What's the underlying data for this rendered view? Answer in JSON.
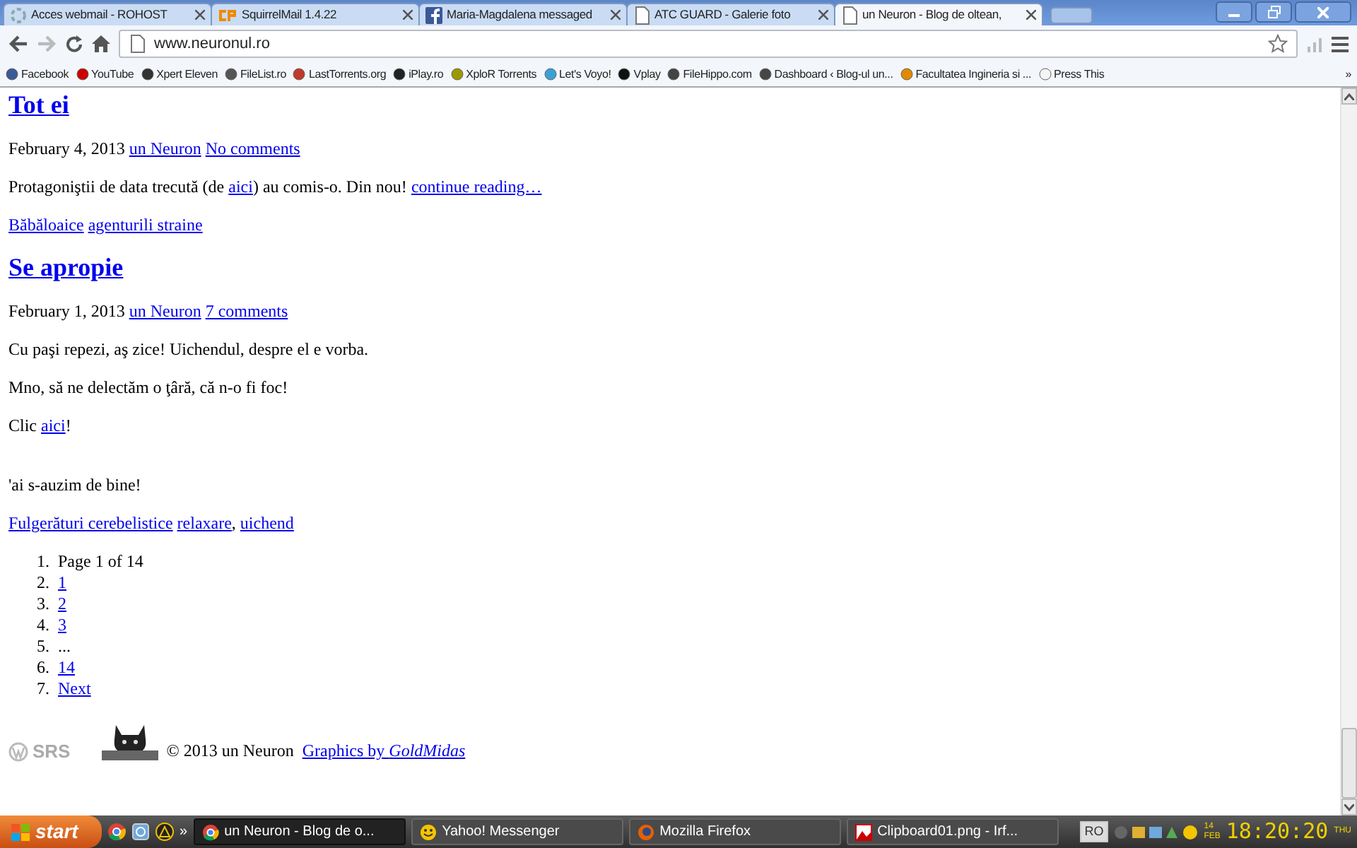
{
  "browser": {
    "tabs": [
      {
        "title": "Acces webmail - ROHOST",
        "kind": "spinner",
        "selected": false
      },
      {
        "title": "SquirrelMail 1.4.22",
        "kind": "cp",
        "selected": false
      },
      {
        "title": "Maria-Magdalena messaged",
        "kind": "facebook",
        "selected": false
      },
      {
        "title": "ATC GUARD - Galerie foto",
        "kind": "page",
        "selected": false
      },
      {
        "title": "un Neuron - Blog de oltean,",
        "kind": "page",
        "selected": true
      }
    ],
    "address": "www.neuronul.ro",
    "bookmarks": [
      {
        "label": "Facebook",
        "color": "#3b5998"
      },
      {
        "label": "YouTube",
        "color": "#cc0000"
      },
      {
        "label": "Xpert Eleven",
        "color": "#333333"
      },
      {
        "label": "FileList.ro",
        "color": "#555555"
      },
      {
        "label": "LastTorrents.org",
        "color": "#c0392b"
      },
      {
        "label": "iPlay.ro",
        "color": "#222222"
      },
      {
        "label": "XploR Torrents",
        "color": "#9a9a00"
      },
      {
        "label": "Let's Voyo!",
        "color": "#3aa0d8"
      },
      {
        "label": "Vplay",
        "color": "#111111"
      },
      {
        "label": "FileHippo.com",
        "color": "#444444"
      },
      {
        "label": "Dashboard ‹ Blog-ul un...",
        "color": "#464646"
      },
      {
        "label": "Facultatea Ingineria si ...",
        "color": "#e08a00"
      },
      {
        "label": "Press This",
        "color": "#f4f4f4"
      }
    ],
    "bookmarks_overflow": "»"
  },
  "posts": [
    {
      "title": "Tot ei",
      "date": "February 4, 2013",
      "author": "un Neuron",
      "comments": "No comments",
      "paragraphs": [
        [
          {
            "kind": "text",
            "text": "Protagoniştii de data trecută (de "
          },
          {
            "kind": "link",
            "text": "aici"
          },
          {
            "kind": "text",
            "text": ") au comis-o. Din nou!  "
          },
          {
            "kind": "link",
            "text": "continue reading…"
          }
        ]
      ],
      "tags": [
        {
          "kind": "link",
          "text": "Băbăloaice"
        },
        {
          "kind": "space"
        },
        {
          "kind": "link",
          "text": "agenturili straine"
        }
      ]
    },
    {
      "title": "Se apropie",
      "date": "February 1, 2013",
      "author": "un Neuron",
      "comments": "7 comments",
      "paragraphs": [
        [
          {
            "kind": "text",
            "text": "Cu paşi repezi, aş zice! Uichendul, despre el e vorba."
          }
        ],
        [
          {
            "kind": "text",
            "text": "Mno, să ne delectăm o ţâră, că n-o fi foc!"
          }
        ],
        [
          {
            "kind": "text",
            "text": "Clic "
          },
          {
            "kind": "link",
            "text": "aici"
          },
          {
            "kind": "text",
            "text": "!"
          }
        ],
        [
          {
            "kind": "gap"
          }
        ],
        [
          {
            "kind": "text",
            "text": "'ai s-auzim de bine!"
          }
        ]
      ],
      "tags": [
        {
          "kind": "link",
          "text": "Fulgerături cerebelistice"
        },
        {
          "kind": "space"
        },
        {
          "kind": "link",
          "text": "relaxare"
        },
        {
          "kind": "text",
          "text": ", "
        },
        {
          "kind": "link",
          "text": "uichend"
        }
      ]
    }
  ],
  "pagination": [
    {
      "marker": "1.",
      "kind": "text",
      "text": "Page 1 of 14"
    },
    {
      "marker": "2.",
      "kind": "link",
      "text": "1"
    },
    {
      "marker": "3.",
      "kind": "link",
      "text": "2"
    },
    {
      "marker": "4.",
      "kind": "link",
      "text": "3"
    },
    {
      "marker": "5.",
      "kind": "text",
      "text": "..."
    },
    {
      "marker": "6.",
      "kind": "link",
      "text": "14"
    },
    {
      "marker": "7.",
      "kind": "link",
      "text": "Next"
    }
  ],
  "footer": {
    "logo_text": "SRS",
    "copyright": "© 2013 un Neuron",
    "credit": "Graphics by *GoldMidas*"
  },
  "taskbar": {
    "start": "start",
    "overflow": "»",
    "tasks": [
      {
        "label": "un Neuron - Blog de o...",
        "kind": "chrome",
        "selected": true
      },
      {
        "label": "Yahoo! Messenger",
        "kind": "smiley",
        "selected": false
      },
      {
        "label": "Mozilla Firefox",
        "kind": "firefox",
        "selected": false
      },
      {
        "label": "Clipboard01.png - Irf...",
        "kind": "image",
        "selected": false
      }
    ],
    "language": "RO",
    "date_day": "14",
    "date_month": "FEB",
    "time": "18:20:20",
    "weekday": "THU"
  }
}
